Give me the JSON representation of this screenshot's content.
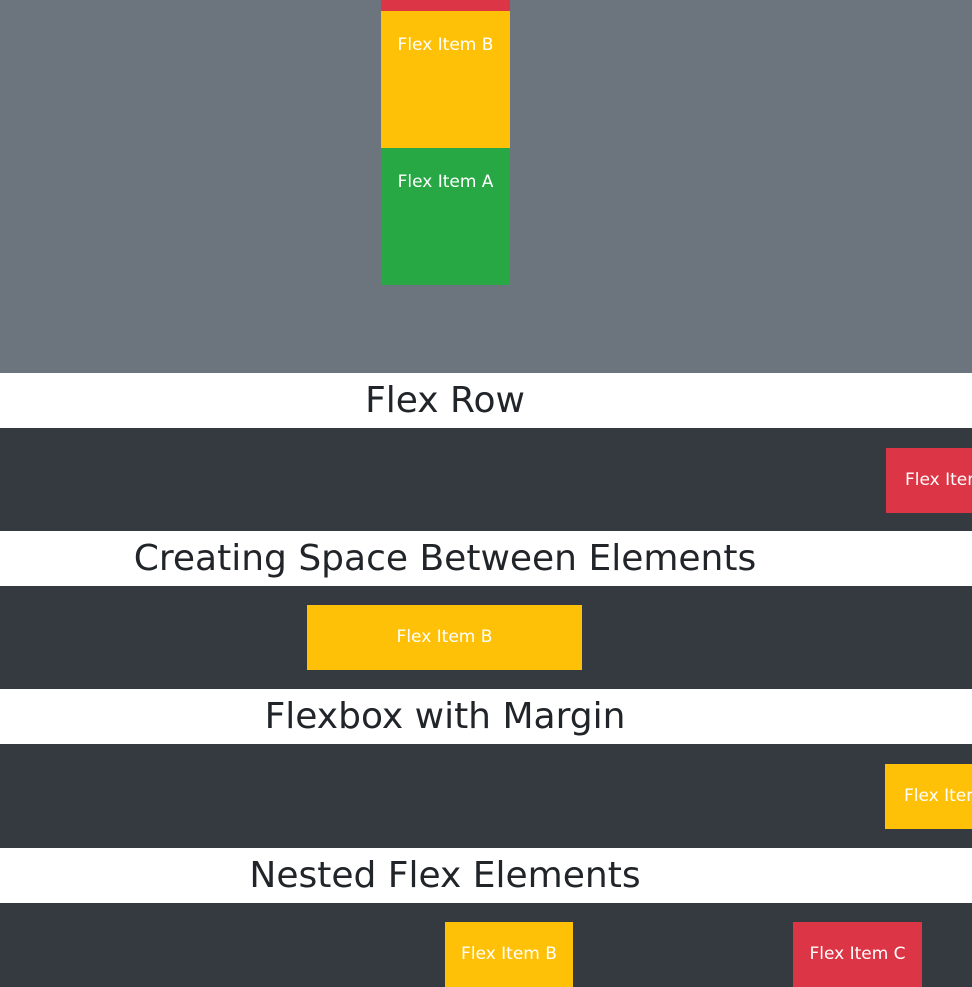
{
  "vertical_demo": {
    "items": [
      "Flex Item B",
      "Flex Item A"
    ]
  },
  "sections": {
    "flex_row": {
      "title": "Flex Row",
      "item": "Flex Item"
    },
    "space_between": {
      "title": "Creating Space Between Elements",
      "item": "Flex Item B"
    },
    "margin": {
      "title": "Flexbox with Margin",
      "item": "Flex Item"
    },
    "nested": {
      "title": "Nested Flex Elements",
      "items": [
        "Flex Item B",
        "Flex Item C"
      ]
    }
  },
  "colors": {
    "gray_background": "#6c757d",
    "dark_background": "#343a40",
    "red": "#dc3545",
    "yellow": "#ffc107",
    "green": "#28a745",
    "text_dark": "#212529",
    "text_light": "#ffffff"
  }
}
